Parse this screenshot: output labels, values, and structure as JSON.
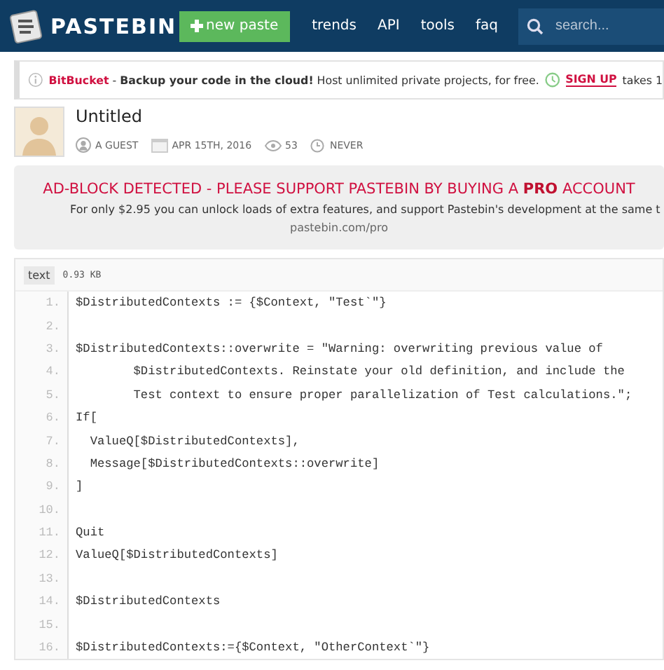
{
  "header": {
    "logo": "PASTEBIN",
    "new_paste": "new paste",
    "nav": [
      "trends",
      "API",
      "tools",
      "faq"
    ],
    "search": {
      "placeholder": "search..."
    }
  },
  "notice": {
    "brand": "BitBucket",
    "text": "- **Backup your code in the cloud!** Host unlimited private projects, for free.",
    "link": "SIGN UP",
    "tail": "takes 1"
  },
  "paste": {
    "title": "Untitled",
    "meta": [
      {
        "kind": "user",
        "text": "A GUEST"
      },
      {
        "kind": "date",
        "text": "APR 15TH, 2016"
      },
      {
        "kind": "views",
        "text": "53"
      },
      {
        "kind": "expire",
        "text": "NEVER"
      }
    ]
  },
  "adblock": {
    "heading": "AD-BLOCK DETECTED - PLEASE SUPPORT PASTEBIN BY BUYING A **PRO** ACCOUNT",
    "text": "For only $2.95 you can unlock loads of extra features, and support Pastebin's development at the same t",
    "link": "pastebin.com/pro"
  },
  "code": {
    "syntax": "text",
    "size": "0.93 KB",
    "lines": [
      {
        "number": "1.",
        "code": "$DistributedContexts := {$Context, \"Test`\"}"
      },
      {
        "number": "2."
      },
      {
        "number": "3.",
        "code": "$DistributedContexts::overwrite = \"Warning: overwriting previous value of"
      },
      {
        "number": "4.",
        "code": "        $DistributedContexts. Reinstate your old definition, and include the"
      },
      {
        "number": "5.",
        "code": "        Test context to ensure proper parallelization of Test calculations.\";"
      },
      {
        "number": "6.",
        "code": "If["
      },
      {
        "number": "7.",
        "code": "  ValueQ[$DistributedContexts],"
      },
      {
        "number": "8.",
        "code": "  Message[$DistributedContexts::overwrite]"
      },
      {
        "number": "9.",
        "code": "]"
      },
      {
        "number": "10."
      },
      {
        "number": "11.",
        "code": "Quit"
      },
      {
        "number": "12.",
        "code": "ValueQ[$DistributedContexts]"
      },
      {
        "number": "13."
      },
      {
        "number": "14.",
        "code": "$DistributedContexts"
      },
      {
        "number": "15."
      },
      {
        "number": "16.",
        "code": "$DistributedContexts:={$Context, \"OtherContext`\"}"
      }
    ]
  }
}
